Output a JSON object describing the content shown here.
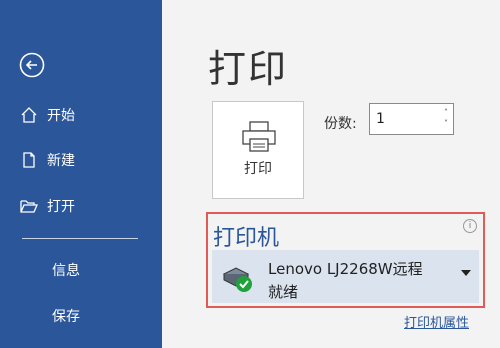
{
  "sidebar": {
    "items": [
      {
        "label": "开始",
        "icon": "home-icon"
      },
      {
        "label": "新建",
        "icon": "new-document-icon"
      },
      {
        "label": "打开",
        "icon": "open-folder-icon"
      }
    ],
    "secondary": [
      {
        "label": "信息"
      },
      {
        "label": "保存"
      }
    ],
    "back_icon": "back-arrow-icon"
  },
  "main": {
    "title": "打印",
    "print_button_label": "打印",
    "copies_label": "份数:",
    "copies_value": "1",
    "printer": {
      "heading": "打印机",
      "name": "Lenovo LJ2268W远程",
      "status": "就绪",
      "properties_link": "打印机属性"
    }
  },
  "colors": {
    "sidebar": "#2b579a",
    "accent": "#2b579a",
    "highlight": "#e05a57",
    "ready": "#1fa13c"
  }
}
